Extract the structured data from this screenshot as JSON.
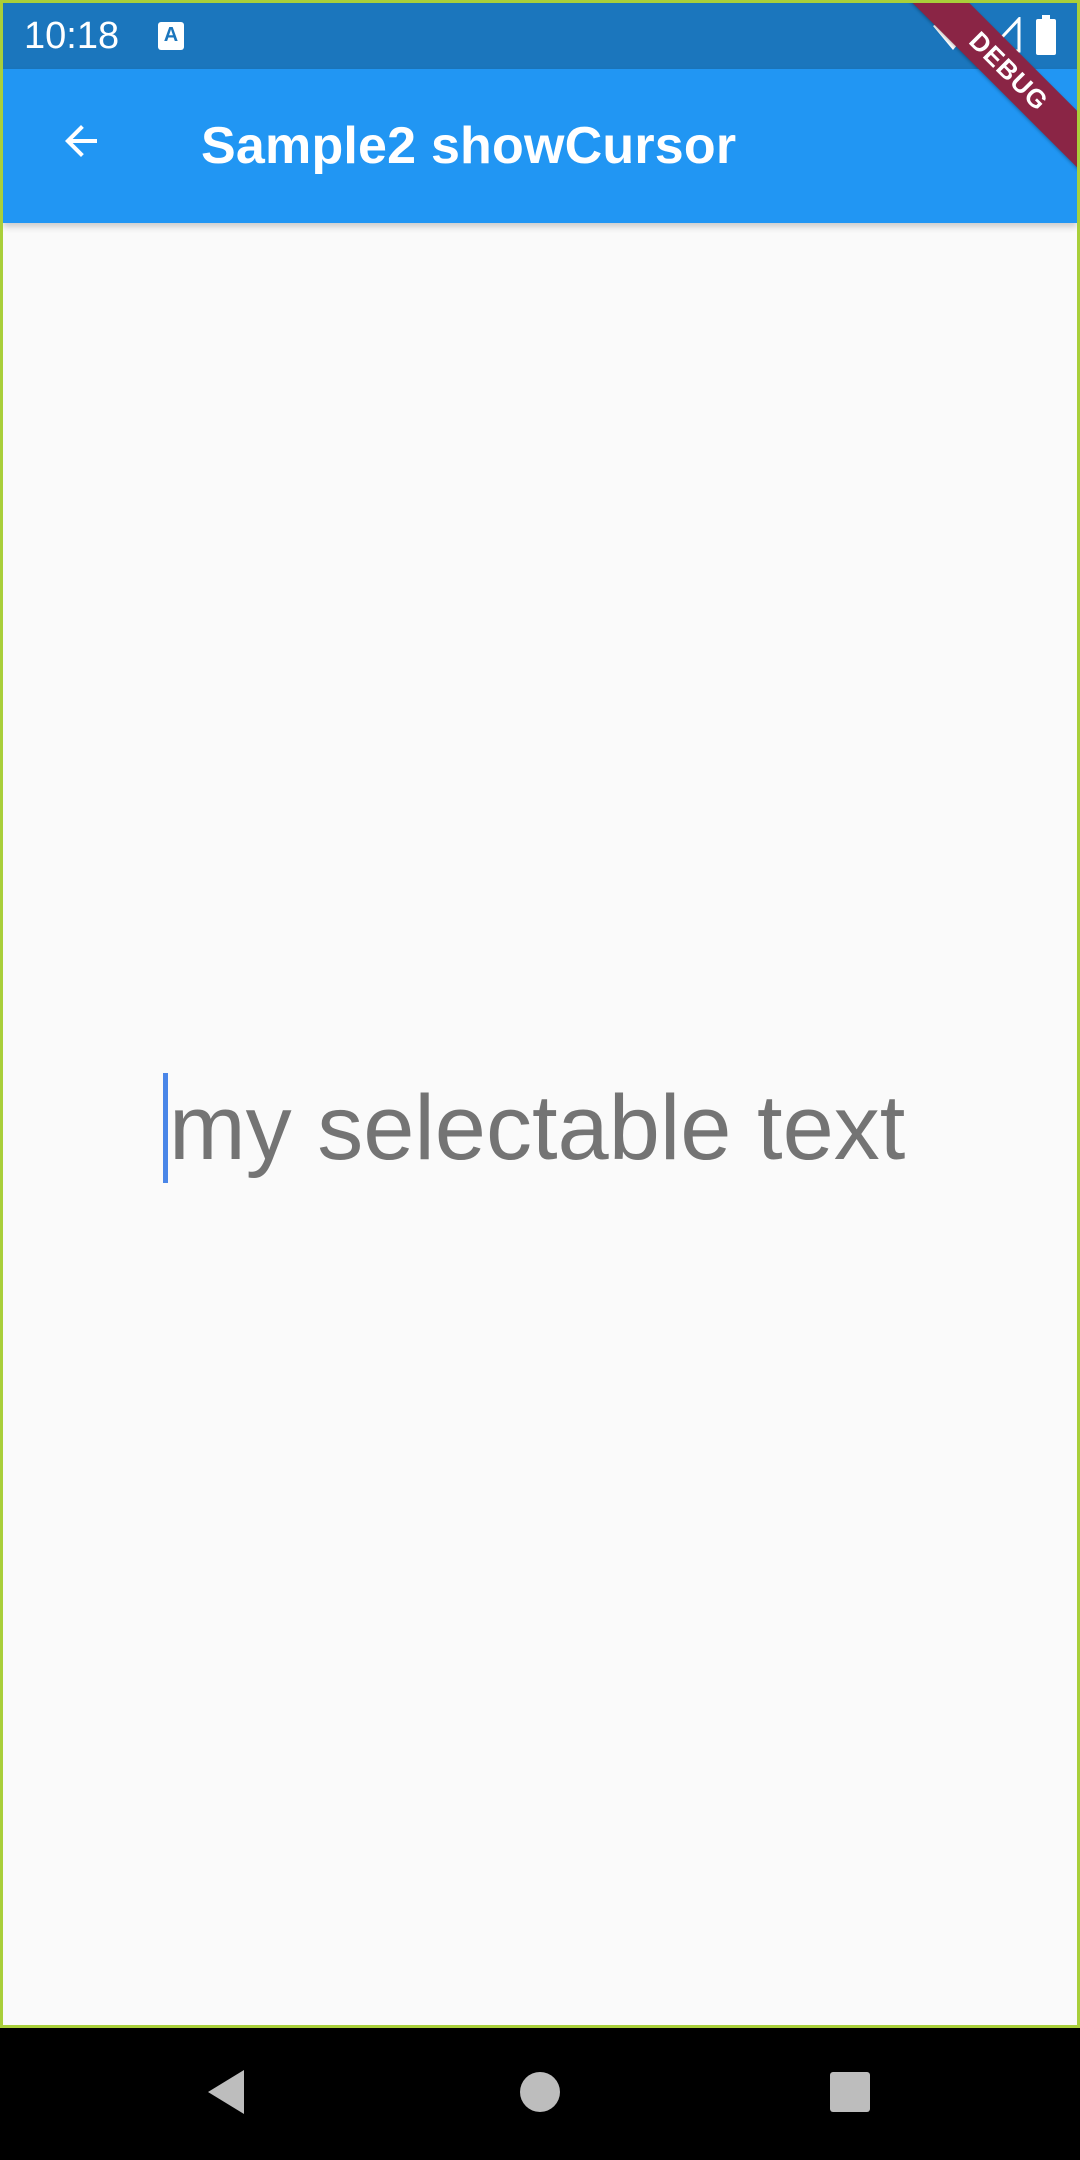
{
  "status_bar": {
    "time": "10:18",
    "notification_icon_letter": "A",
    "icons": [
      "wifi-icon",
      "cell-signal-icon",
      "battery-icon"
    ]
  },
  "app_bar": {
    "title": "Sample2 showCursor",
    "back_icon": "arrow-back-icon",
    "background_color": "#2196f3",
    "status_bar_color": "#1b76bd"
  },
  "debug_banner": {
    "label": "DEBUG",
    "color": "#8a2545"
  },
  "content": {
    "selectable_text": "my selectable text",
    "cursor_visible": true,
    "cursor_color": "#4a86e8",
    "text_color": "#747474"
  },
  "nav_bar": {
    "buttons": [
      "back-triangle-icon",
      "home-circle-icon",
      "recents-square-icon"
    ]
  }
}
